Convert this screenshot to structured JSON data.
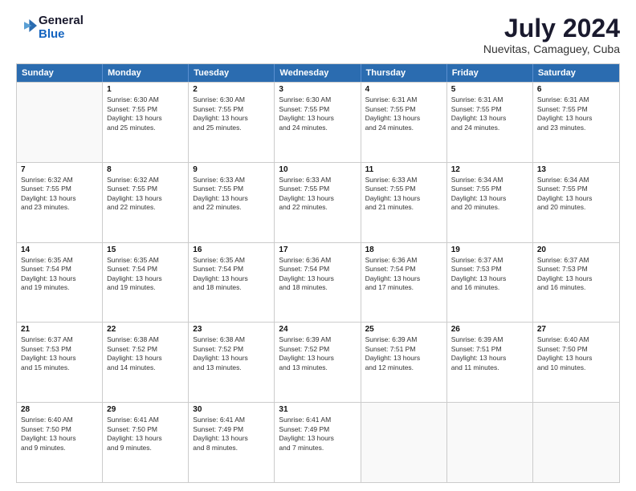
{
  "logo": {
    "line1": "General",
    "line2": "Blue"
  },
  "header": {
    "month_year": "July 2024",
    "location": "Nuevitas, Camaguey, Cuba"
  },
  "days_of_week": [
    "Sunday",
    "Monday",
    "Tuesday",
    "Wednesday",
    "Thursday",
    "Friday",
    "Saturday"
  ],
  "weeks": [
    [
      {
        "day": "",
        "info": ""
      },
      {
        "day": "1",
        "info": "Sunrise: 6:30 AM\nSunset: 7:55 PM\nDaylight: 13 hours\nand 25 minutes."
      },
      {
        "day": "2",
        "info": "Sunrise: 6:30 AM\nSunset: 7:55 PM\nDaylight: 13 hours\nand 25 minutes."
      },
      {
        "day": "3",
        "info": "Sunrise: 6:30 AM\nSunset: 7:55 PM\nDaylight: 13 hours\nand 24 minutes."
      },
      {
        "day": "4",
        "info": "Sunrise: 6:31 AM\nSunset: 7:55 PM\nDaylight: 13 hours\nand 24 minutes."
      },
      {
        "day": "5",
        "info": "Sunrise: 6:31 AM\nSunset: 7:55 PM\nDaylight: 13 hours\nand 24 minutes."
      },
      {
        "day": "6",
        "info": "Sunrise: 6:31 AM\nSunset: 7:55 PM\nDaylight: 13 hours\nand 23 minutes."
      }
    ],
    [
      {
        "day": "7",
        "info": "Sunrise: 6:32 AM\nSunset: 7:55 PM\nDaylight: 13 hours\nand 23 minutes."
      },
      {
        "day": "8",
        "info": "Sunrise: 6:32 AM\nSunset: 7:55 PM\nDaylight: 13 hours\nand 22 minutes."
      },
      {
        "day": "9",
        "info": "Sunrise: 6:33 AM\nSunset: 7:55 PM\nDaylight: 13 hours\nand 22 minutes."
      },
      {
        "day": "10",
        "info": "Sunrise: 6:33 AM\nSunset: 7:55 PM\nDaylight: 13 hours\nand 22 minutes."
      },
      {
        "day": "11",
        "info": "Sunrise: 6:33 AM\nSunset: 7:55 PM\nDaylight: 13 hours\nand 21 minutes."
      },
      {
        "day": "12",
        "info": "Sunrise: 6:34 AM\nSunset: 7:55 PM\nDaylight: 13 hours\nand 20 minutes."
      },
      {
        "day": "13",
        "info": "Sunrise: 6:34 AM\nSunset: 7:55 PM\nDaylight: 13 hours\nand 20 minutes."
      }
    ],
    [
      {
        "day": "14",
        "info": "Sunrise: 6:35 AM\nSunset: 7:54 PM\nDaylight: 13 hours\nand 19 minutes."
      },
      {
        "day": "15",
        "info": "Sunrise: 6:35 AM\nSunset: 7:54 PM\nDaylight: 13 hours\nand 19 minutes."
      },
      {
        "day": "16",
        "info": "Sunrise: 6:35 AM\nSunset: 7:54 PM\nDaylight: 13 hours\nand 18 minutes."
      },
      {
        "day": "17",
        "info": "Sunrise: 6:36 AM\nSunset: 7:54 PM\nDaylight: 13 hours\nand 18 minutes."
      },
      {
        "day": "18",
        "info": "Sunrise: 6:36 AM\nSunset: 7:54 PM\nDaylight: 13 hours\nand 17 minutes."
      },
      {
        "day": "19",
        "info": "Sunrise: 6:37 AM\nSunset: 7:53 PM\nDaylight: 13 hours\nand 16 minutes."
      },
      {
        "day": "20",
        "info": "Sunrise: 6:37 AM\nSunset: 7:53 PM\nDaylight: 13 hours\nand 16 minutes."
      }
    ],
    [
      {
        "day": "21",
        "info": "Sunrise: 6:37 AM\nSunset: 7:53 PM\nDaylight: 13 hours\nand 15 minutes."
      },
      {
        "day": "22",
        "info": "Sunrise: 6:38 AM\nSunset: 7:52 PM\nDaylight: 13 hours\nand 14 minutes."
      },
      {
        "day": "23",
        "info": "Sunrise: 6:38 AM\nSunset: 7:52 PM\nDaylight: 13 hours\nand 13 minutes."
      },
      {
        "day": "24",
        "info": "Sunrise: 6:39 AM\nSunset: 7:52 PM\nDaylight: 13 hours\nand 13 minutes."
      },
      {
        "day": "25",
        "info": "Sunrise: 6:39 AM\nSunset: 7:51 PM\nDaylight: 13 hours\nand 12 minutes."
      },
      {
        "day": "26",
        "info": "Sunrise: 6:39 AM\nSunset: 7:51 PM\nDaylight: 13 hours\nand 11 minutes."
      },
      {
        "day": "27",
        "info": "Sunrise: 6:40 AM\nSunset: 7:50 PM\nDaylight: 13 hours\nand 10 minutes."
      }
    ],
    [
      {
        "day": "28",
        "info": "Sunrise: 6:40 AM\nSunset: 7:50 PM\nDaylight: 13 hours\nand 9 minutes."
      },
      {
        "day": "29",
        "info": "Sunrise: 6:41 AM\nSunset: 7:50 PM\nDaylight: 13 hours\nand 9 minutes."
      },
      {
        "day": "30",
        "info": "Sunrise: 6:41 AM\nSunset: 7:49 PM\nDaylight: 13 hours\nand 8 minutes."
      },
      {
        "day": "31",
        "info": "Sunrise: 6:41 AM\nSunset: 7:49 PM\nDaylight: 13 hours\nand 7 minutes."
      },
      {
        "day": "",
        "info": ""
      },
      {
        "day": "",
        "info": ""
      },
      {
        "day": "",
        "info": ""
      }
    ]
  ]
}
